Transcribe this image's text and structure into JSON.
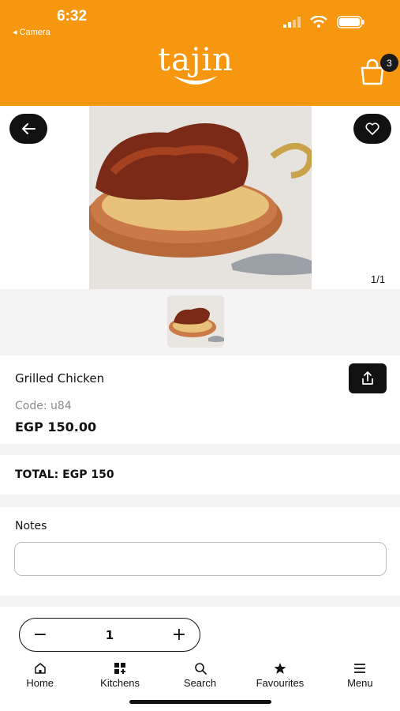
{
  "status": {
    "time": "6:32",
    "back_app": "◂ Camera"
  },
  "header": {
    "logo": "tajin",
    "cart_count": "3"
  },
  "gallery": {
    "counter": "1/1"
  },
  "product": {
    "name": "Grilled Chicken",
    "code": "Code: u84",
    "price": "EGP 150.00"
  },
  "order": {
    "total": "TOTAL: EGP 150"
  },
  "notes": {
    "label": "Notes",
    "value": ""
  },
  "quantity": {
    "minus": "−",
    "value": "1",
    "plus": "+"
  },
  "nav": [
    {
      "label": "Home",
      "icon": "home-icon"
    },
    {
      "label": "Kitchens",
      "icon": "kitchens-icon"
    },
    {
      "label": "Search",
      "icon": "search-icon"
    },
    {
      "label": "Favourites",
      "icon": "star-icon"
    },
    {
      "label": "Menu",
      "icon": "menu-icon"
    }
  ],
  "colors": {
    "brand": "#f7960f",
    "dark": "#111111"
  }
}
